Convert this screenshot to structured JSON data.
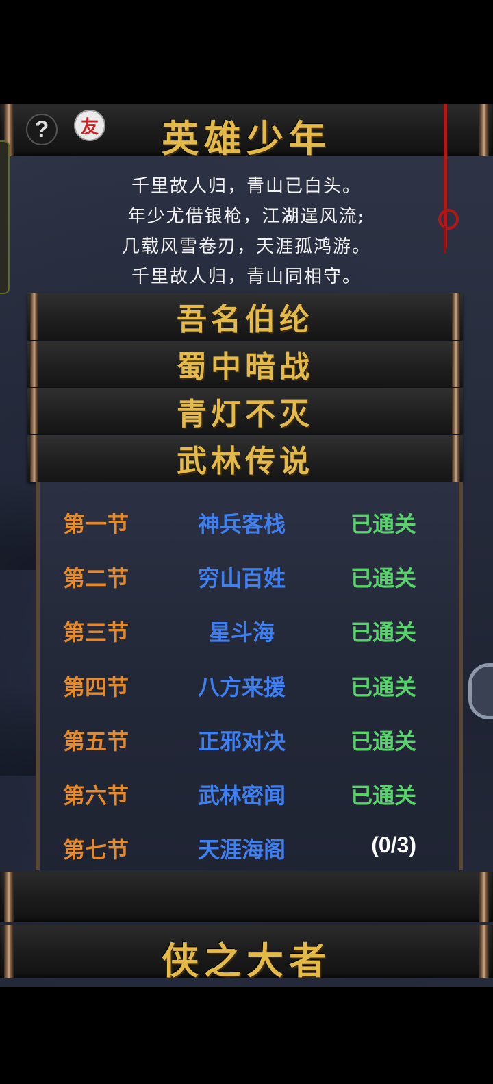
{
  "book_title": "英雄少年",
  "poem": [
    "千里故人归，青山已白头。",
    "年少尤借银枪，江湖逞风流;",
    "几载风雪卷刃，天涯孤鸿游。",
    "千里故人归，青山同相守。"
  ],
  "chapters": [
    {
      "label": "吾名伯纶"
    },
    {
      "label": "蜀中暗战"
    },
    {
      "label": "青灯不灭"
    },
    {
      "label": "武林传说"
    }
  ],
  "sections": [
    {
      "num": "第一节",
      "name": "神兵客栈",
      "status": "已通关"
    },
    {
      "num": "第二节",
      "name": "穷山百姓",
      "status": "已通关"
    },
    {
      "num": "第三节",
      "name": "星斗海",
      "status": "已通关"
    },
    {
      "num": "第四节",
      "name": "八方来援",
      "status": "已通关"
    },
    {
      "num": "第五节",
      "name": "正邪对决",
      "status": "已通关"
    },
    {
      "num": "第六节",
      "name": "武林密闻",
      "status": "已通关"
    },
    {
      "num": "第七节",
      "name": "天涯海阁",
      "status": "(0/3)"
    }
  ],
  "next_book_title": "侠之大者",
  "icons": {
    "help": "?",
    "friend": "友"
  },
  "colors": {
    "gold": "#e3ba4a",
    "section_number": "#e58a2c",
    "section_name": "#3f7ff0",
    "cleared": "#58d26a"
  }
}
